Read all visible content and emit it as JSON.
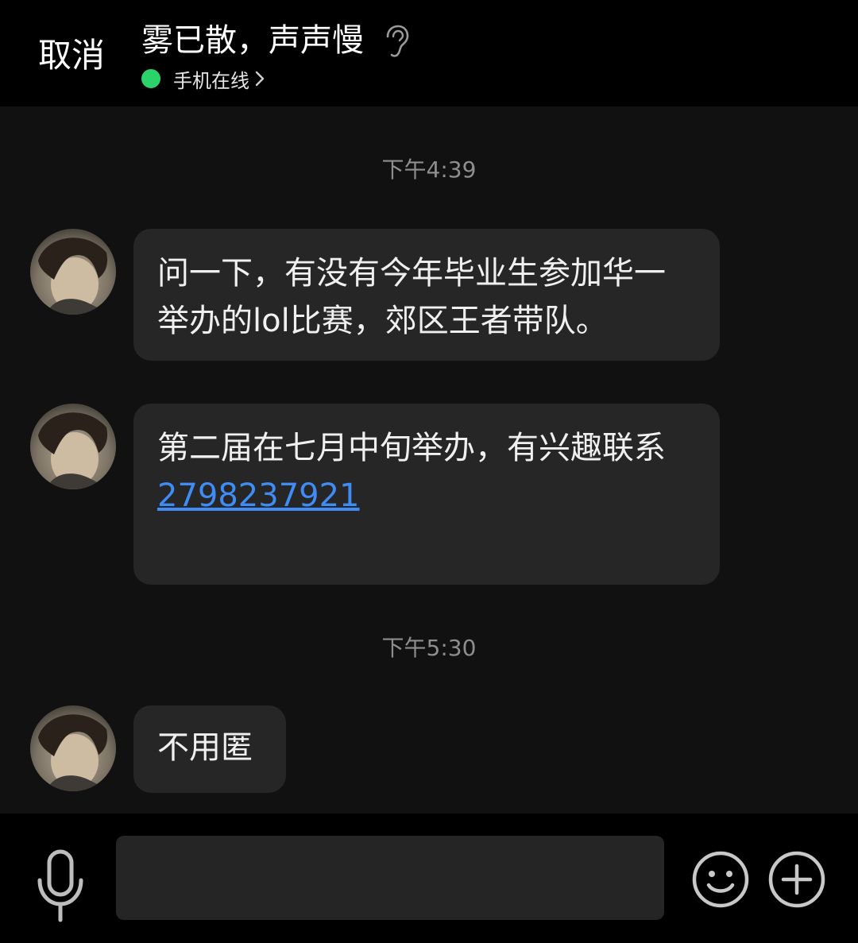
{
  "header": {
    "cancel_label": "取消",
    "contact_name": "雾已散，声声慢",
    "status_text": "手机在线"
  },
  "messages": [
    {
      "time": "下午4:39",
      "text": "问一下，有没有今年毕业生参加华一举办的lol比赛，郊区王者带队。"
    },
    {
      "text": "第二届在七月中旬举办，有兴趣联系",
      "link": "2798237921"
    },
    {
      "time": "下午5:30",
      "text": "不用匿"
    }
  ],
  "input": {
    "placeholder": "",
    "value": ""
  },
  "colors": {
    "header_bg": "#000000",
    "chat_bg": "#111111",
    "bubble_bg": "#262626",
    "online_dot": "#2bd46a",
    "link": "#3f8cf5",
    "timestamp": "#8e8e8e"
  },
  "icons": [
    "ear-icon",
    "chevron-right-icon",
    "mic-icon",
    "emoji-icon",
    "plus-icon",
    "avatar"
  ]
}
